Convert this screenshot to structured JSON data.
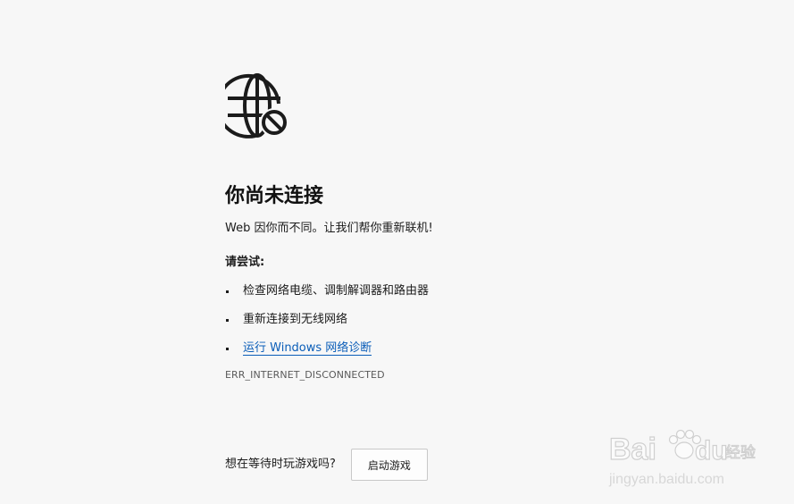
{
  "error_page": {
    "icon": "globe-blocked-icon",
    "title": "你尚未连接",
    "subtitle": "Web 因你而不同。让我们帮你重新联机!",
    "try_heading": "请尝试:",
    "suggestions": [
      "检查网络电缆、调制解调器和路由器",
      "重新连接到无线网络",
      "运行 Windows 网络诊断"
    ],
    "error_code": "ERR_INTERNET_DISCONNECTED",
    "game_prompt": "想在等待时玩游戏吗?",
    "game_button": "启动游戏"
  },
  "watermark": {
    "brand": "Bai",
    "brand_suffix": "du",
    "brand_cn": "经验",
    "url": "jingyan.baidu.com"
  },
  "colors": {
    "background": "#f7f7f7",
    "link": "#0a5db8",
    "text": "#1b1b1b"
  }
}
